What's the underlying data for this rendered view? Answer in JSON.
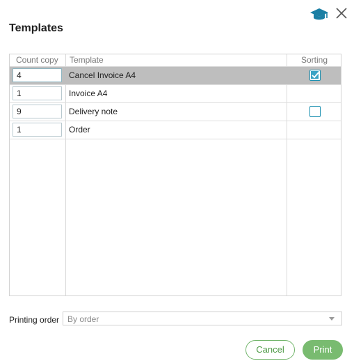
{
  "dialog": {
    "title": "Templates"
  },
  "icons": {
    "help": "graduation-cap-icon",
    "close": "close-icon",
    "accent": "#1a7fa4"
  },
  "table": {
    "headers": {
      "count": "Count copy",
      "template": "Template",
      "sorting": "Sorting"
    },
    "rows": [
      {
        "count": "4",
        "template": "Cancel Invoice A4",
        "sorting": "checked",
        "selected": true
      },
      {
        "count": "1",
        "template": "Invoice A4",
        "sorting": "none",
        "selected": false
      },
      {
        "count": "9",
        "template": "Delivery note",
        "sorting": "unchecked",
        "selected": false
      },
      {
        "count": "1",
        "template": "Order",
        "sorting": "none",
        "selected": false
      }
    ]
  },
  "printing_order": {
    "label": "Printing order",
    "value": "By order"
  },
  "buttons": {
    "cancel": "Cancel",
    "print": "Print"
  },
  "colors": {
    "selected_row": "#bebebe",
    "checkbox": "#1a8fb0",
    "button_green": "#79bb70"
  }
}
